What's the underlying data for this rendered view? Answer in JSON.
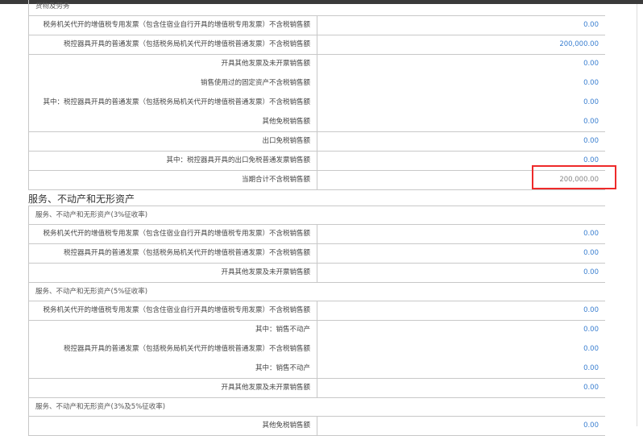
{
  "goods": {
    "header": "货物及劳务",
    "rows": [
      {
        "label": "税务机关代开的增值税专用发票（包含住宿业自行开具的增值税专用发票）不含税销售额",
        "value": "0.00"
      },
      {
        "label": "税控器具开具的普通发票（包括税务局机关代开的增值税普通发票）不含税销售额",
        "value": "200,000.00"
      },
      {
        "label": "开具其他发票及未开票销售额",
        "value": "0.00"
      },
      {
        "label": "销售使用过的固定资产不含税销售额",
        "value": "0.00"
      },
      {
        "label": "其中：税控器具开具的普通发票（包括税务局机关代开的增值税普通发票）不含税销售额",
        "value": "0.00"
      },
      {
        "label": "其他免税销售额",
        "value": "0.00"
      },
      {
        "label": "出口免税销售额",
        "value": "0.00"
      },
      {
        "label": "其中：税控器具开具的出口免税普通发票销售额",
        "value": "0.00"
      },
      {
        "label": "当期合计不含税销售额",
        "value": "200,000.00"
      }
    ]
  },
  "services": {
    "title": "服务、不动产和无形资产",
    "g3": {
      "header": "服务、不动产和无形资产(3%征收率)",
      "rows": [
        {
          "label": "税务机关代开的增值税专用发票（包含住宿业自行开具的增值税专用发票）不含税销售额",
          "value": "0.00"
        },
        {
          "label": "税控器具开具的普通发票（包括税务局机关代开的增值税普通发票）不含税销售额",
          "value": "0.00"
        },
        {
          "label": "开具其他发票及未开票销售额",
          "value": "0.00"
        }
      ]
    },
    "g5": {
      "header": "服务、不动产和无形资产(5%征收率)",
      "rows": [
        {
          "label": "税务机关代开的增值税专用发票（包含住宿业自行开具的增值税专用发票）不含税销售额",
          "value": "0.00"
        },
        {
          "label": "其中：销售不动产",
          "value": "0.00"
        },
        {
          "label": "税控器具开具的普通发票（包括税务局机关代开的增值税普通发票）不含税销售额",
          "value": "0.00"
        },
        {
          "label": "其中：销售不动产",
          "value": "0.00"
        },
        {
          "label": "开具其他发票及未开票销售额",
          "value": "0.00"
        }
      ]
    },
    "g35": {
      "header": "服务、不动产和无形资产(3%及5%征收率)",
      "rows": [
        {
          "label": "其他免税销售额",
          "value": "0.00"
        }
      ]
    }
  }
}
